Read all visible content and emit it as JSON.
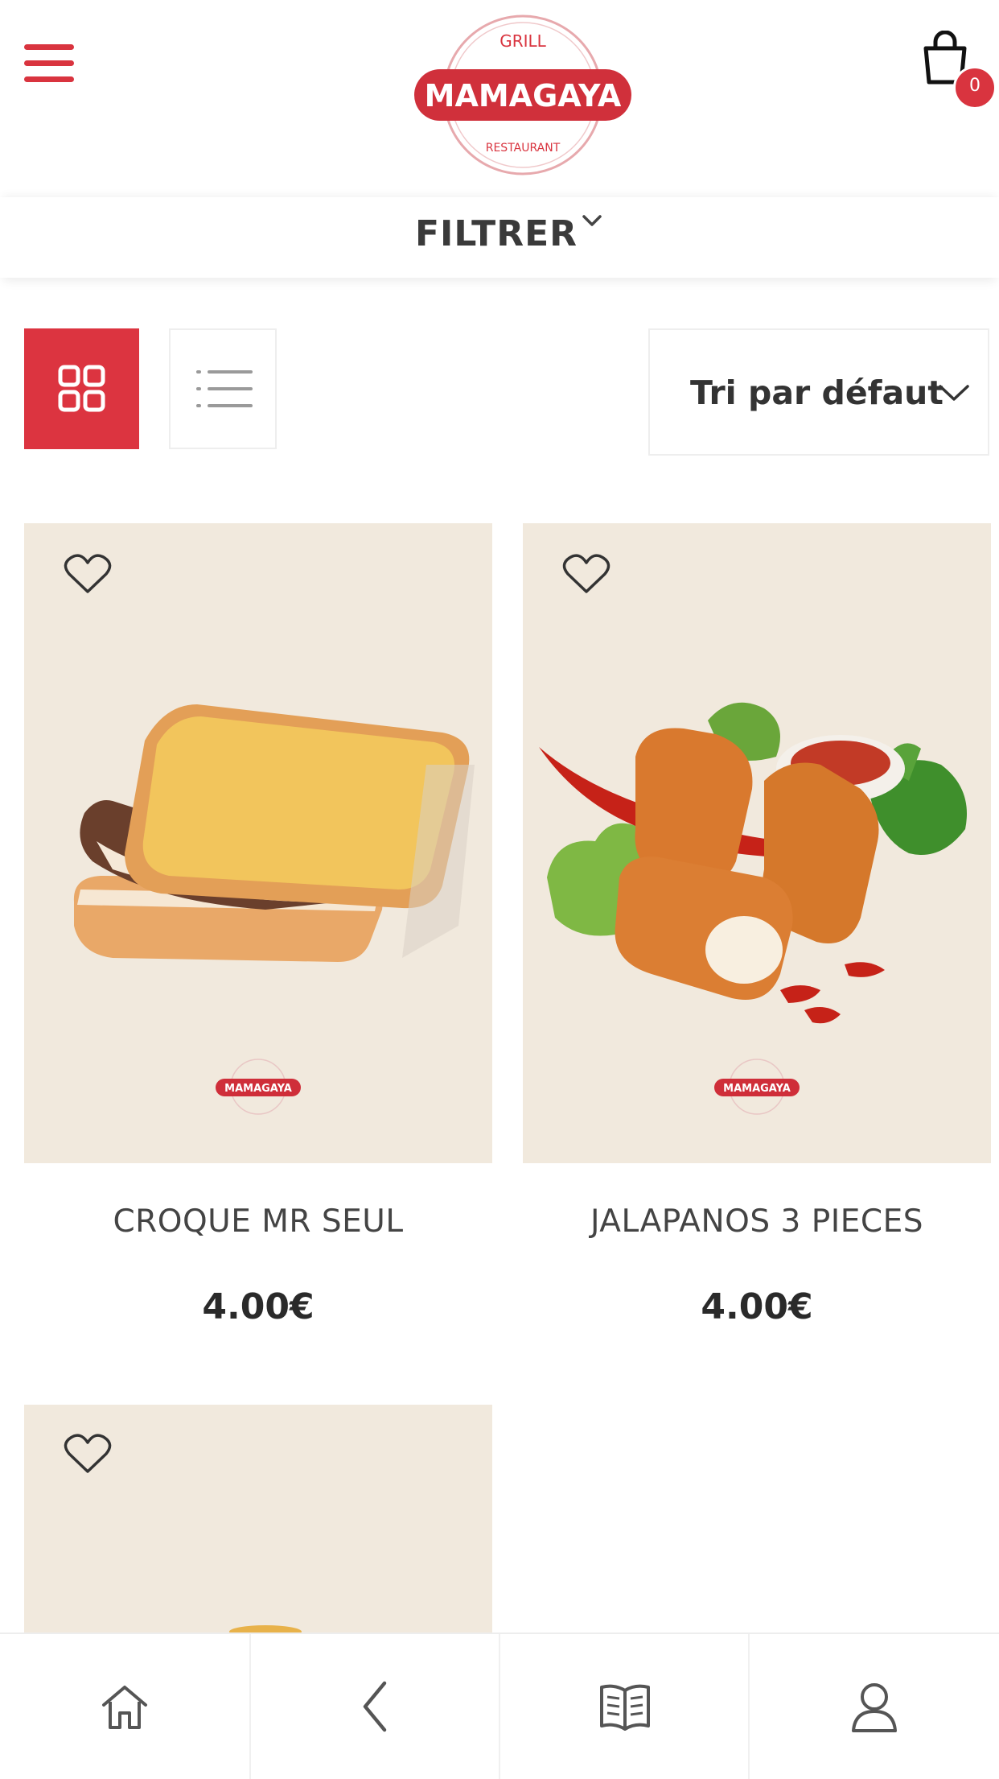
{
  "header": {
    "logo_main": "MAMAGAYA",
    "logo_top": "GRILL",
    "logo_bottom": "RESTAURANT",
    "cart_count": "0"
  },
  "filter": {
    "label": "FILTRER"
  },
  "toolbar": {
    "sort_label": "Tri par défaut"
  },
  "products": [
    {
      "name": "CROQUE MR SEUL",
      "price": "4.00€"
    },
    {
      "name": "JALAPANOS 3 PIECES",
      "price": "4.00€"
    },
    {
      "name": "",
      "price": ""
    }
  ],
  "colors": {
    "brand_red": "#dc3440",
    "card_bg": "#f1e9dd",
    "text_dark": "#333333"
  },
  "icons": {
    "menu": "hamburger-icon",
    "cart": "shopping-bag-icon",
    "filter": "chevron-down-icon",
    "grid": "grid-view-icon",
    "list": "list-view-icon",
    "wishlist": "heart-icon",
    "home": "home-icon",
    "back": "chevron-left-icon",
    "menu_book": "book-icon",
    "account": "user-icon"
  }
}
